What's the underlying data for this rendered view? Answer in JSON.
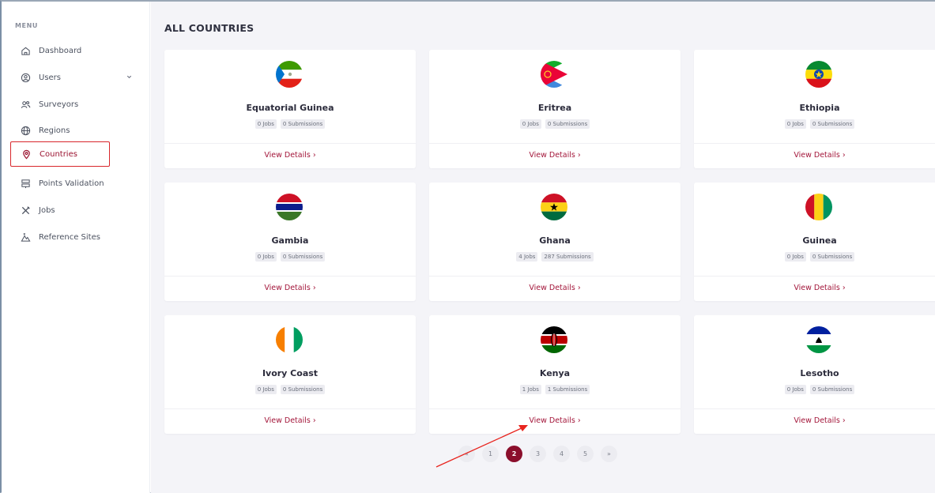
{
  "sidebar": {
    "menu_title": "MENU",
    "items": [
      {
        "label": "Dashboard",
        "icon": "home-icon"
      },
      {
        "label": "Users",
        "icon": "user-circle-icon"
      },
      {
        "label": "Surveyors",
        "icon": "users-icon"
      },
      {
        "label": "Regions",
        "icon": "globe-icon"
      },
      {
        "label": "Countries",
        "icon": "map-pin-icon"
      },
      {
        "label": "Points Validation",
        "icon": "signpost-icon"
      },
      {
        "label": "Jobs",
        "icon": "tools-icon"
      },
      {
        "label": "Reference Sites",
        "icon": "mountain-icon"
      }
    ]
  },
  "main": {
    "title": "ALL COUNTRIES",
    "cards": [
      {
        "name": "Equatorial Guinea",
        "jobs": "0 Jobs",
        "submissions": "0 Submissions",
        "link": "View Details ›"
      },
      {
        "name": "Eritrea",
        "jobs": "0 Jobs",
        "submissions": "0 Submissions",
        "link": "View Details ›"
      },
      {
        "name": "Ethiopia",
        "jobs": "0 Jobs",
        "submissions": "0 Submissions",
        "link": "View Details ›"
      },
      {
        "name": "Gambia",
        "jobs": "0 Jobs",
        "submissions": "0 Submissions",
        "link": "View Details ›"
      },
      {
        "name": "Ghana",
        "jobs": "4 Jobs",
        "submissions": "287 Submissions",
        "link": "View Details ›"
      },
      {
        "name": "Guinea",
        "jobs": "0 Jobs",
        "submissions": "0 Submissions",
        "link": "View Details ›"
      },
      {
        "name": "Ivory Coast",
        "jobs": "0 Jobs",
        "submissions": "0 Submissions",
        "link": "View Details ›"
      },
      {
        "name": "Kenya",
        "jobs": "1 Jobs",
        "submissions": "1 Submissions",
        "link": "View Details ›"
      },
      {
        "name": "Lesotho",
        "jobs": "0 Jobs",
        "submissions": "0 Submissions",
        "link": "View Details ›"
      }
    ]
  },
  "pagination": {
    "prev": "«",
    "pages": [
      "1",
      "2",
      "3",
      "4",
      "5"
    ],
    "current": "2",
    "next": "»"
  },
  "colors": {
    "accent": "#8b0f2c",
    "link": "#a3163a",
    "highlight_box": "#d8262b",
    "annotation_arrow": "#e8251f"
  }
}
